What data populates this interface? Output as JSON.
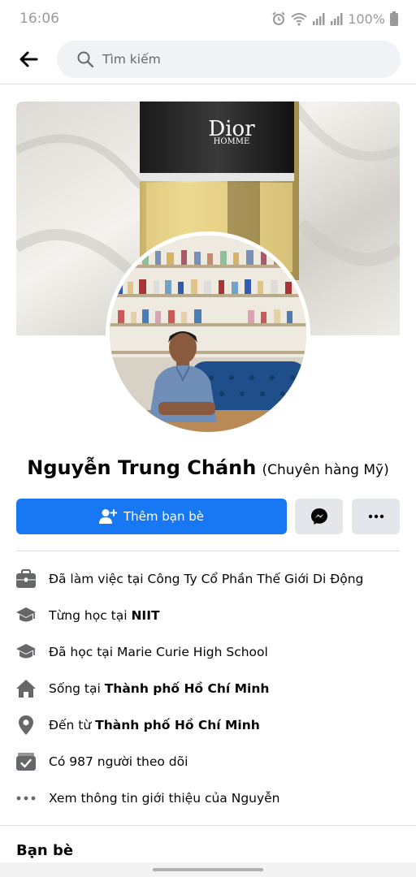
{
  "status_bar": {
    "time": "16:06",
    "battery": "100%",
    "icons": [
      "alarm-icon",
      "wifi-icon",
      "signal-icon",
      "signal-icon",
      "battery-icon"
    ]
  },
  "header": {
    "back_icon": "arrow-left-icon",
    "search_placeholder": "Tìm kiếm",
    "search_icon": "search-icon"
  },
  "cover": {
    "brand_text": "Dior",
    "brand_sub": "HOMME"
  },
  "profile": {
    "name": "Nguyễn Trung Chánh",
    "alternate_name": "(Chuyên hàng Mỹ)"
  },
  "actions": {
    "add_friend_label": "Thêm bạn bè",
    "add_friend_icon": "person-add-icon",
    "messenger_icon": "messenger-icon",
    "more_icon": "more-icon",
    "primary_color": "#1877f2"
  },
  "info": [
    {
      "icon": "briefcase-icon",
      "prefix": "Đã làm việc tại Công Ty Cổ Phần Thế Giới Di Động",
      "bold": ""
    },
    {
      "icon": "graduation-cap-icon",
      "prefix": "Từng học tại ",
      "bold": "NIIT"
    },
    {
      "icon": "graduation-cap-icon",
      "prefix": "Đã học tại Marie Curie High School",
      "bold": ""
    },
    {
      "icon": "home-icon",
      "prefix": "Sống tại ",
      "bold": "Thành phố Hồ Chí Minh"
    },
    {
      "icon": "location-pin-icon",
      "prefix": "Đến từ ",
      "bold": "Thành phố Hồ Chí Minh"
    },
    {
      "icon": "followers-icon",
      "prefix": "Có 987 người theo dõi",
      "bold": ""
    },
    {
      "icon": "more-horizontal-icon",
      "prefix": "Xem thông tin giới thiệu của Nguyễn",
      "bold": ""
    }
  ],
  "friends_section": {
    "title": "Bạn bè"
  }
}
